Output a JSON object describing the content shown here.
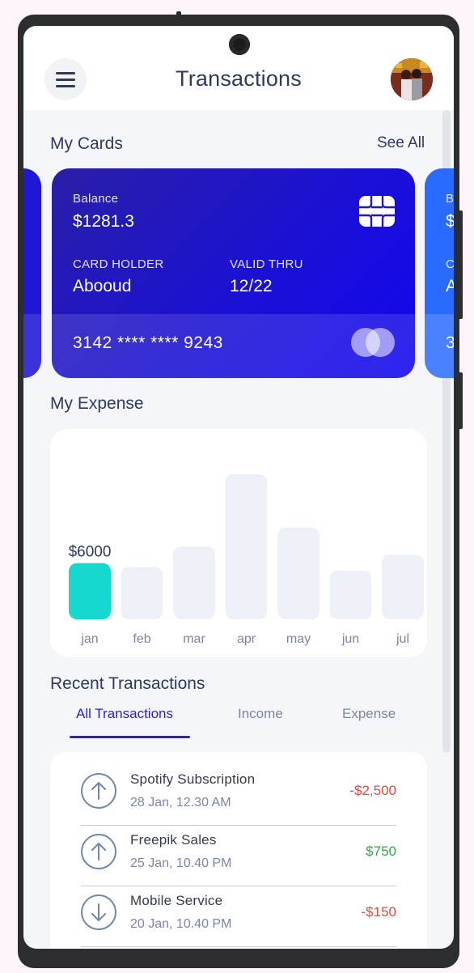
{
  "header": {
    "title": "Transactions"
  },
  "cards_section": {
    "title": "My Cards",
    "see_all": "See All"
  },
  "card": {
    "balance_label": "Balance",
    "balance": "$1281.3",
    "holder_label": "CARD HOLDER",
    "holder": "Abooud",
    "valid_label": "VALID THRU",
    "valid": "12/22",
    "number": "3142 **** **** 9243"
  },
  "side_card": {
    "balance_label_partial": "B",
    "balance_partial": "$",
    "holder_label_partial": "C",
    "holder_partial": "A",
    "number_partial": "3"
  },
  "expense_section": {
    "title": "My Expense"
  },
  "chart_data": {
    "type": "bar",
    "categories": [
      "jan",
      "feb",
      "mar",
      "apr",
      "may",
      "jun",
      "jul"
    ],
    "values": [
      6000,
      5600,
      7800,
      15500,
      9800,
      5200,
      6900
    ],
    "highlighted_index": 0,
    "highlight_label": "$6000",
    "highlight_color": "#14d9cc",
    "bar_color": "#edf0f6",
    "ylim": [
      0,
      16000
    ]
  },
  "transactions_section": {
    "title": "Recent Transactions",
    "tabs": [
      "All Transactions",
      "Income",
      "Expense"
    ],
    "active_tab": 0
  },
  "transactions": [
    {
      "name": "Spotify Subscription",
      "date": "28 Jan, 12.30 AM",
      "amount": "-$2,500",
      "direction": "up",
      "color": "#e8473d"
    },
    {
      "name": "Freepik Sales",
      "date": "25 Jan, 10.40 PM",
      "amount": "$750",
      "direction": "up",
      "color": "#3aa34a"
    },
    {
      "name": "Mobile Service",
      "date": "20 Jan, 10.40 PM",
      "amount": "-$150",
      "direction": "down",
      "color": "#e8473d"
    }
  ],
  "colors": {
    "accent": "#2a1fd8",
    "title": "#2f3a5f",
    "muted": "#7a86a3"
  }
}
